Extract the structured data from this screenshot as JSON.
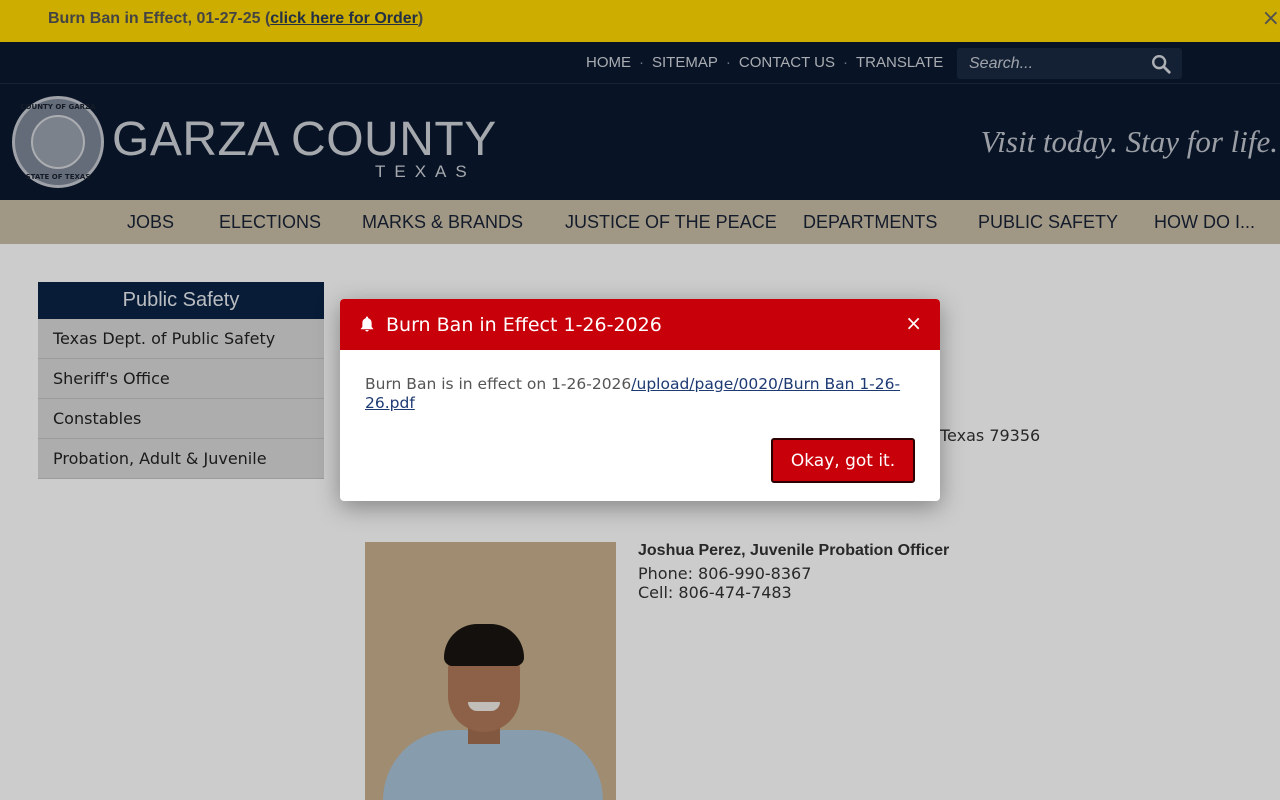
{
  "alert_bar": {
    "text": "Burn Ban in Effect, 01-27-25 (",
    "link": "click here for Order",
    "text_after": ")",
    "close_glyph": "×"
  },
  "utility_nav": {
    "items": [
      "HOME",
      "SITEMAP",
      "CONTACT US",
      "TRANSLATE"
    ],
    "separator": "·",
    "search_placeholder": "Search..."
  },
  "brand": {
    "name": "GARZA COUNTY",
    "subtitle": "TEXAS",
    "seal_top": "COUNTY OF GARZA",
    "seal_bottom": "STATE OF TEXAS",
    "tagline": "Visit today. Stay for life."
  },
  "main_nav": {
    "items": [
      "JOBS",
      "ELECTIONS",
      "MARKS & BRANDS",
      "JUSTICE OF THE PEACE",
      "DEPARTMENTS",
      "PUBLIC SAFETY",
      "HOW DO I..."
    ]
  },
  "sidebar": {
    "heading": "Public Safety",
    "items": [
      "Texas Dept. of Public Safety",
      "Sheriff's Office",
      "Constables",
      "Probation, Adult & Juvenile"
    ]
  },
  "content": {
    "address_tail": "Texas  79356",
    "staff": {
      "name": "Joshua Perez, Juvenile Probation Officer",
      "phone": "Phone: 806-990-8367",
      "cell": "Cell: 806-474-7483"
    }
  },
  "modal": {
    "title": "Burn Ban in Effect 1-26-2026",
    "body_text": "Burn Ban is in effect on 1-26-2026",
    "body_link": "/upload/page/0020/Burn Ban 1-26-26.pdf",
    "close_glyph": "×",
    "ok_label": "Okay, got it."
  },
  "colors": {
    "alert_yellow": "#ffd900",
    "header_navy": "#0b1a30",
    "nav_tan": "#c9bfa7",
    "modal_red": "#c8000a",
    "sidebar_head": "#0b2447"
  }
}
